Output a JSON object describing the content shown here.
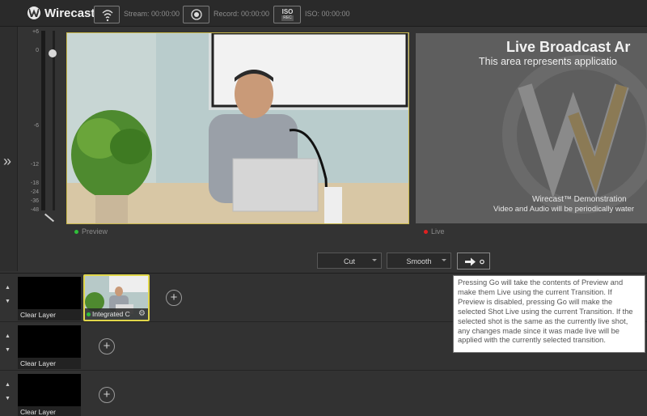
{
  "app": {
    "title": "Wirecast"
  },
  "toolbar": {
    "stream_text": "Stream: 00:00:00",
    "record_text": "Record: 00:00:00",
    "iso_icon_text": "ISO",
    "iso_icon_sub": "REC",
    "iso_text": "ISO: 00:00:00"
  },
  "meter": {
    "ticks": [
      "+6",
      "0",
      "-6",
      "-12",
      "-18",
      "-24",
      "-36",
      "-48"
    ]
  },
  "preview": {
    "label": "Preview",
    "status_color": "#2fbf3a"
  },
  "live": {
    "title": "Live Broadcast Ar",
    "subtitle": "This area represents applicatio",
    "demo_line1": "Wirecast™ Demonstration",
    "demo_line2": "Video and Audio will be periodically water",
    "label": "Live",
    "status_color": "#e02020"
  },
  "transitions": {
    "cut_label": "Cut",
    "smooth_label": "Smooth",
    "go_icon": "go-arrow-icon"
  },
  "layers": {
    "rows": [
      {
        "shots": [
          {
            "label": "Clear Layer"
          },
          {
            "label": "Integrated C"
          }
        ]
      },
      {
        "shots": [
          {
            "label": "Clear Layer"
          }
        ]
      },
      {
        "shots": [
          {
            "label": "Clear Layer"
          }
        ]
      }
    ]
  },
  "tooltip": {
    "text": "Pressing Go will take the contents of Preview and make them Live using the current Transition. If Preview is disabled, pressing Go will make the selected Shot Live using the current Transition. If the selected shot is the same as the currently live shot, any changes made since it was made live will be applied with the currently selected transition."
  },
  "colors": {
    "accent_yellow": "#e0d64a",
    "background": "#333333"
  }
}
